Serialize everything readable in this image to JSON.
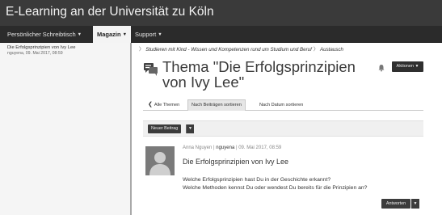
{
  "app": {
    "title": "E-Learning an der Universität zu Köln"
  },
  "nav": {
    "items": [
      {
        "label": "Persönlicher Schreibtisch"
      },
      {
        "label": "Magazin"
      },
      {
        "label": "Support"
      }
    ],
    "active_index": 1
  },
  "sidebar": {
    "entries": [
      {
        "title": "Die Erfolgsprinzipien von Ivy Lee",
        "meta": "nguyena, 09. Mai 2017, 08:59"
      }
    ]
  },
  "breadcrumb": {
    "items": [
      "Studieren mit Kind - Wissen und Kompetenzen rund um Studium und Beruf",
      "Austausch"
    ]
  },
  "thread": {
    "title": "Thema \"Die Erfolgsprinzipien von Ivy Lee\"",
    "actions_label": "Aktionen",
    "icon": "forum-thread-icon",
    "notify_icon": "bell-icon"
  },
  "tabs": {
    "items": [
      {
        "label": "Alle Themen"
      },
      {
        "label": "Nach Beiträgen sortieren"
      },
      {
        "label": "Nach Datum sortieren"
      }
    ],
    "active_index": 1
  },
  "toolbar": {
    "new_post_label": "Neuer Beitrag"
  },
  "post": {
    "author_name": "Anna Nguyen",
    "author_login": "nguyena",
    "date": "09. Mai 2017, 08:59",
    "subject": "Die Erfolgsprinzipien von Ivy Lee",
    "body_lines": [
      "Welche Erfolgsprinzipien hast Du in der Geschichte erkannt?",
      "Welche Methoden kennst Du oder wendest Du bereits für die Prinzipien an?"
    ],
    "reply_label": "Antworten"
  },
  "colors": {
    "topbar": "#3a3a3a",
    "navbar": "#2b2b2b",
    "button_dark": "#3c3c3c",
    "sidebar_bg": "#f5f5f5"
  }
}
